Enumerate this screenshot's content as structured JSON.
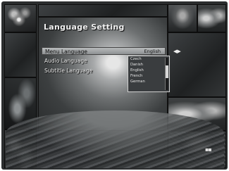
{
  "screen": {
    "title": "Language Setting"
  },
  "menu": {
    "rows": [
      {
        "label": "Menu Language",
        "value": "English",
        "selected": true
      },
      {
        "label": "Audio Language",
        "value": ""
      },
      {
        "label": "Subtitle Language",
        "value": ""
      }
    ]
  },
  "dropdown": {
    "options": [
      "Czech",
      "Danish",
      "English",
      "French",
      "German"
    ],
    "scroll_position": 0.4
  },
  "icons": {
    "nav_arrow": "arrow-indicator-icon",
    "corner_logo": "brand-logo-icon"
  },
  "colors": {
    "highlight": "#a6a9ab",
    "panel": "#3a3d3f"
  }
}
